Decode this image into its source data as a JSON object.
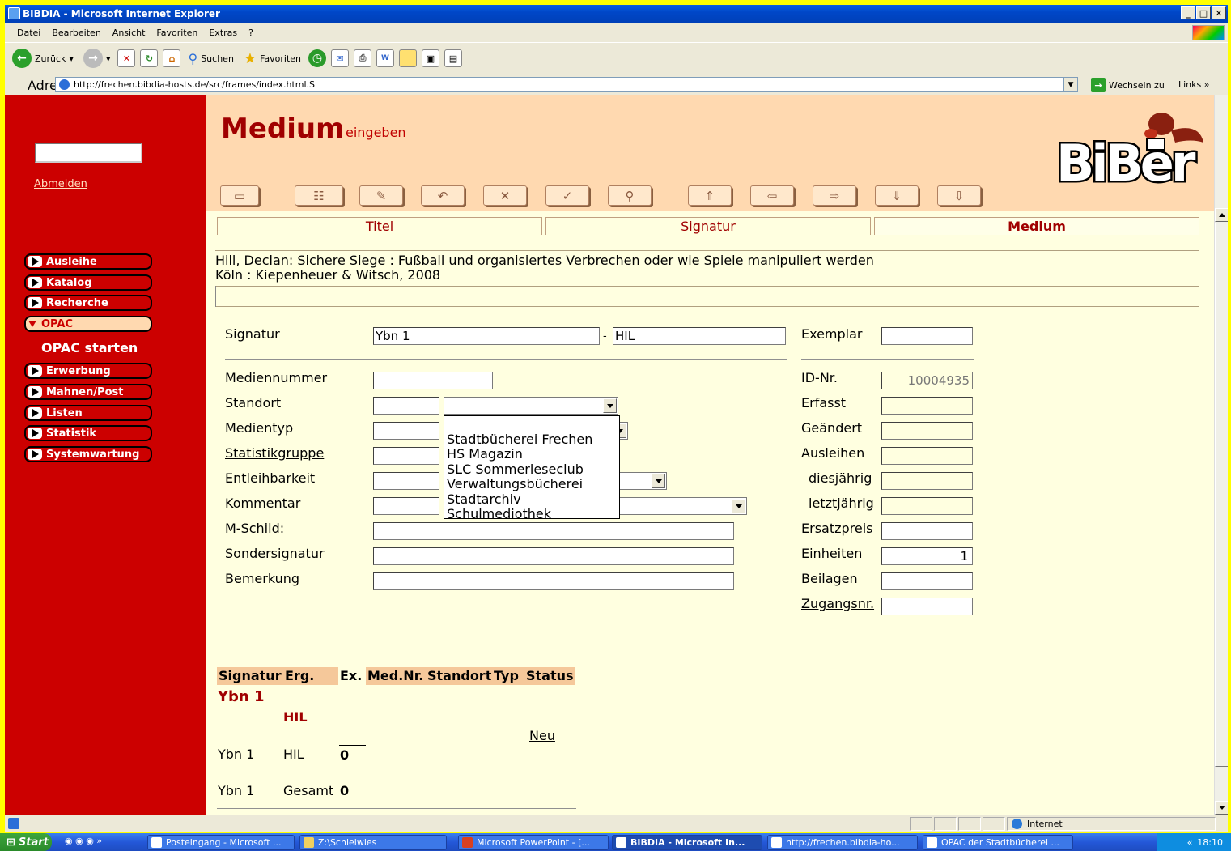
{
  "window": {
    "title": "BIBDIA - Microsoft Internet Explorer"
  },
  "menu": [
    "Datei",
    "Bearbeiten",
    "Ansicht",
    "Favoriten",
    "Extras",
    "?"
  ],
  "toolbar": {
    "back": "Zurück",
    "search": "Suchen",
    "favorites": "Favoriten"
  },
  "address": {
    "label": "Adresse",
    "url": "http://frechen.bibdia-hosts.de/src/frames/index.html.S",
    "go": "Wechseln zu",
    "links": "Links"
  },
  "sidebar": {
    "logout": "Abmelden",
    "items": [
      "Ausleihe",
      "Katalog",
      "Recherche",
      "OPAC",
      "Erwerbung",
      "Mahnen/Post",
      "Listen",
      "Statistik",
      "Systemwartung"
    ],
    "opac_start": "OPAC starten"
  },
  "header": {
    "title": "Medium",
    "subtitle": "eingeben",
    "logo": "BiBer"
  },
  "tabs": [
    "Titel",
    "Signatur",
    "Medium"
  ],
  "bib": {
    "line1": "Hill, Declan: Sichere Siege : Fußball und organisiertes Verbrechen oder wie Spiele manipuliert werden",
    "line2": "Köln : Kiepenheuer & Witsch, 2008"
  },
  "form": {
    "signatur_label": "Signatur",
    "signatur1": "Ybn 1",
    "signatur_sep": "-",
    "signatur2": "HIL",
    "exemplar_label": "Exemplar",
    "mediennummer": "Mediennummer",
    "standort": "Standort",
    "medientyp": "Medientyp",
    "statistikgruppe": "Statistikgruppe",
    "entleihbarkeit": "Entleihbarkeit",
    "kommentar": "Kommentar",
    "mschild": "M-Schild:",
    "sondersignatur": "Sondersignatur",
    "bemerkung": "Bemerkung",
    "idnr_label": "ID-Nr.",
    "idnr": "10004935",
    "erfasst": "Erfasst",
    "geaendert": "Geändert",
    "ausleihen": "Ausleihen",
    "diesjaehrig": "diesjährig",
    "letztjaehrig": "letztjährig",
    "ersatzpreis": "Ersatzpreis",
    "einheiten_label": "Einheiten",
    "einheiten": "1",
    "beilagen": "Beilagen",
    "zugangsnr": "Zugangsnr."
  },
  "dropdown_options": [
    "Stadtbücherei Frechen",
    "HS Magazin",
    "SLC Sommerleseclub",
    "Verwaltungsbücherei",
    "Stadtarchiv",
    "Schulmediothek"
  ],
  "table": {
    "headers": [
      "Signatur",
      "Erg.",
      "Ex.",
      "Med.Nr.",
      "Standort",
      "Typ",
      "Status"
    ],
    "group_sig": "Ybn 1",
    "group_erg": "HIL",
    "neu": "Neu",
    "row_sig": "Ybn 1",
    "row_erg": "HIL",
    "row_ex": "0",
    "total_sig": "Ybn 1",
    "total_label": "Gesamt",
    "total_val": "0"
  },
  "status": {
    "zone": "Internet"
  },
  "taskbar": {
    "start": "Start",
    "tasks": [
      "Posteingang - Microsoft ...",
      "Z:\\Schleiwies",
      "Microsoft PowerPoint - [...",
      "BIBDIA - Microsoft In...",
      "http://frechen.bibdia-ho...",
      "OPAC der Stadtbücherei ..."
    ],
    "clock": "18:10"
  }
}
